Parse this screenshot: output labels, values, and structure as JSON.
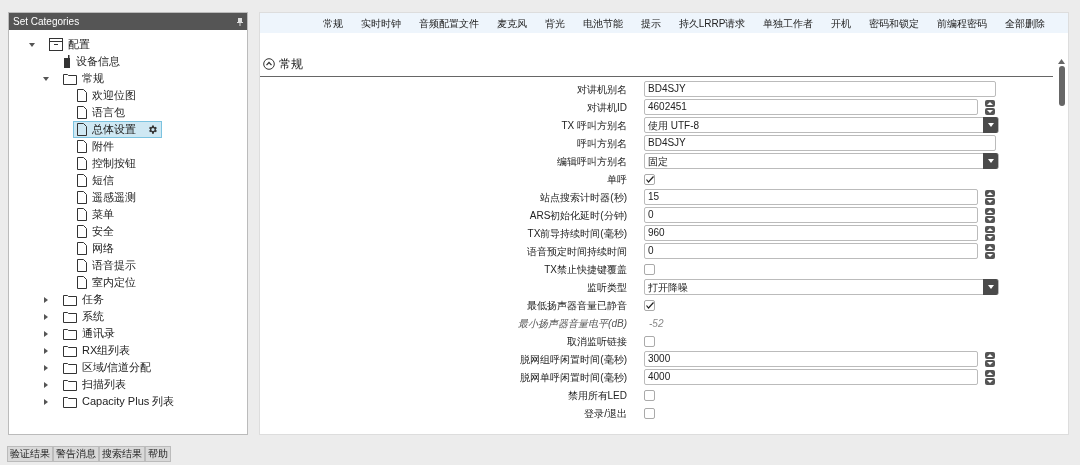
{
  "sidebar": {
    "title": "Set Categories",
    "tree": [
      {
        "label": "配置",
        "kind": "archive",
        "expanded": true,
        "selected": false,
        "children": [
          {
            "label": "设备信息",
            "kind": "device",
            "selected": false
          },
          {
            "label": "常规",
            "kind": "folder",
            "expanded": true,
            "selected": false,
            "children": [
              {
                "label": "欢迎位图",
                "kind": "page",
                "selected": false
              },
              {
                "label": "语言包",
                "kind": "page",
                "selected": false
              },
              {
                "label": "总体设置",
                "kind": "page",
                "selected": true
              },
              {
                "label": "附件",
                "kind": "page",
                "selected": false
              },
              {
                "label": "控制按钮",
                "kind": "page",
                "selected": false
              },
              {
                "label": "短信",
                "kind": "page",
                "selected": false
              },
              {
                "label": "遥感遥测",
                "kind": "page",
                "selected": false
              },
              {
                "label": "菜单",
                "kind": "page",
                "selected": false
              },
              {
                "label": "安全",
                "kind": "page",
                "selected": false
              },
              {
                "label": "网络",
                "kind": "page",
                "selected": false
              },
              {
                "label": "语音提示",
                "kind": "page",
                "selected": false
              },
              {
                "label": "室内定位",
                "kind": "page",
                "selected": false
              }
            ]
          },
          {
            "label": "任务",
            "kind": "folder",
            "expanded": false,
            "selected": false
          },
          {
            "label": "系统",
            "kind": "folder",
            "expanded": false,
            "selected": false
          },
          {
            "label": "通讯录",
            "kind": "folder",
            "expanded": false,
            "selected": false
          },
          {
            "label": "RX组列表",
            "kind": "folder",
            "expanded": false,
            "selected": false
          },
          {
            "label": "区域/信道分配",
            "kind": "folder",
            "expanded": false,
            "selected": false
          },
          {
            "label": "扫描列表",
            "kind": "folder",
            "expanded": false,
            "selected": false
          },
          {
            "label": "Capacity Plus 列表",
            "kind": "folder",
            "expanded": false,
            "selected": false
          }
        ]
      }
    ]
  },
  "bottom_tabs": [
    {
      "label": "验证结果",
      "selected": false
    },
    {
      "label": "警告消息",
      "selected": false
    },
    {
      "label": "搜索结果",
      "selected": false
    },
    {
      "label": "帮助",
      "selected": false
    }
  ],
  "nav_links": [
    "常规",
    "实时时钟",
    "音频配置文件",
    "麦克风",
    "背光",
    "电池节能",
    "提示",
    "持久LRRP请求",
    "单独工作者",
    "开机",
    "密码和锁定",
    "前编程密码",
    "全部删除"
  ],
  "section": {
    "title": "常规",
    "expanded": true,
    "rows": [
      {
        "kind": "text",
        "label": "对讲机别名",
        "value": "BD4SJY"
      },
      {
        "kind": "spin",
        "label": "对讲机ID",
        "value": "4602451"
      },
      {
        "kind": "select",
        "label": "TX 呼叫方别名",
        "value": "使用 UTF-8"
      },
      {
        "kind": "text",
        "label": "呼叫方别名",
        "value": "BD4SJY"
      },
      {
        "kind": "select",
        "label": "编辑呼叫方别名",
        "value": "固定"
      },
      {
        "kind": "check",
        "label": "单呼",
        "checked": true
      },
      {
        "kind": "spin",
        "label": "站点搜索计时器(秒)",
        "value": "15"
      },
      {
        "kind": "spin",
        "label": "ARS初始化延时(分钟)",
        "value": "0"
      },
      {
        "kind": "spin",
        "label": "TX前导持续时间(毫秒)",
        "value": "960"
      },
      {
        "kind": "spin",
        "label": "语音预定时间持续时间",
        "value": "0"
      },
      {
        "kind": "check",
        "label": "TX禁止快捷键覆盖",
        "checked": false
      },
      {
        "kind": "select",
        "label": "监听类型",
        "value": "打开降噪"
      },
      {
        "kind": "check",
        "label": "最低扬声器音量已静音",
        "checked": true
      },
      {
        "kind": "readonly",
        "label": "最小扬声器音量电平(dB)",
        "value": "-52"
      },
      {
        "kind": "check",
        "label": "取消监听链接",
        "checked": false
      },
      {
        "kind": "spin",
        "label": "脱网组呼闲置时间(毫秒)",
        "value": "3000"
      },
      {
        "kind": "spin",
        "label": "脱网单呼闲置时间(毫秒)",
        "value": "4000"
      },
      {
        "kind": "check",
        "label": "禁用所有LED",
        "checked": false
      },
      {
        "kind": "check",
        "label": "登录/退出",
        "checked": false
      }
    ]
  }
}
